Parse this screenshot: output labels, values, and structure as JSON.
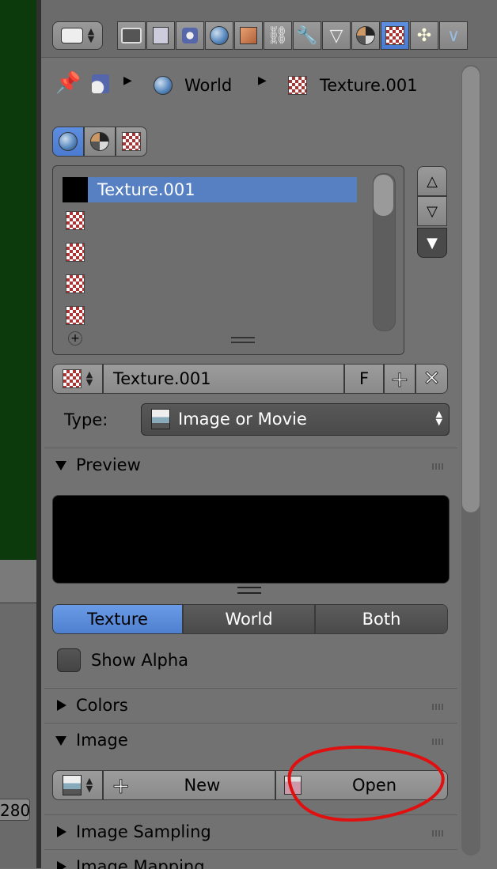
{
  "viewport": {
    "frame_number": "280"
  },
  "breadcrumb": {
    "world": "World",
    "texture": "Texture.001"
  },
  "tabs": [
    "render-icon",
    "render-layers-icon",
    "scene-icon",
    "world-icon",
    "object-icon",
    "constraints-icon",
    "modifiers-icon",
    "data-icon",
    "material-icon",
    "texture-icon",
    "particles-icon",
    "physics-icon"
  ],
  "texture_list": {
    "selected": "Texture.001"
  },
  "datablock": {
    "name": "Texture.001",
    "fake_user": "F"
  },
  "type": {
    "label": "Type:",
    "value": "Image or Movie"
  },
  "preview": {
    "title": "Preview",
    "segments": [
      "Texture",
      "World",
      "Both"
    ],
    "active_segment": "Texture",
    "show_alpha": "Show Alpha"
  },
  "colors": {
    "title": "Colors"
  },
  "image": {
    "title": "Image",
    "new_label": "New",
    "open_label": "Open"
  },
  "image_sampling": {
    "title": "Image Sampling"
  },
  "image_mapping": {
    "title": "Image Mapping"
  },
  "annotation_color": "#e01010",
  "accent_color": "#5680c2"
}
